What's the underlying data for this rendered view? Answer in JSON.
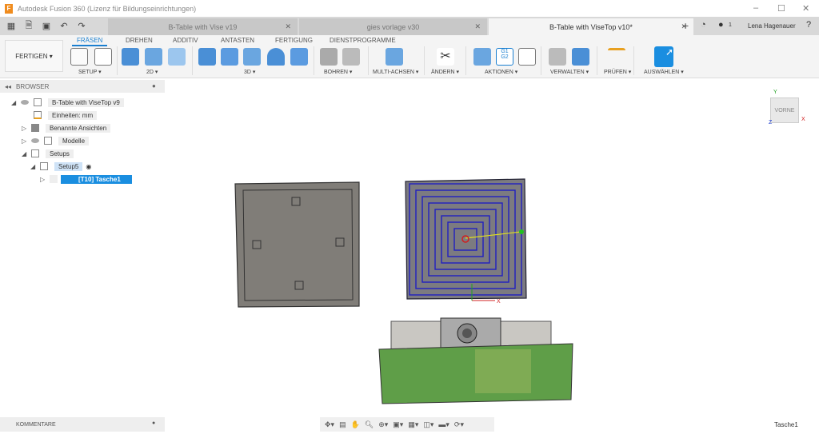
{
  "window": {
    "title": "Autodesk Fusion 360 (Lizenz für Bildungseinrichtungen)",
    "logo": "F"
  },
  "doc_tabs": [
    {
      "label": "B-Table with Vise v19"
    },
    {
      "label": "gies vorlage v30"
    },
    {
      "label": "B-Table with ViseTop v10*"
    }
  ],
  "user": {
    "name": "Lena Hagenauer",
    "jobs": "1"
  },
  "ribbon": {
    "workspace": "FERTIGEN ▾",
    "tabs": [
      "FRÄSEN",
      "DREHEN",
      "ADDITIV",
      "ANTASTEN",
      "FERTIGUNG",
      "DIENSTPROGRAMME"
    ],
    "groups": [
      "SETUP ▾",
      "2D ▾",
      "3D ▾",
      "BOHREN ▾",
      "MULTI-ACHSEN ▾",
      "ÄNDERN ▾",
      "AKTIONEN ▾",
      "VERWALTEN ▾",
      "PRÜFEN ▾",
      "AUSWÄHLEN ▾"
    ]
  },
  "browser": {
    "title": "BROWSER",
    "items": [
      {
        "label": "B-Table with ViseTop v9"
      },
      {
        "label": "Einheiten: mm"
      },
      {
        "label": "Benannte Ansichten"
      },
      {
        "label": "Modelle"
      },
      {
        "label": "Setups"
      },
      {
        "label": "Setup5"
      },
      {
        "label": "[T10] Tasche1"
      }
    ]
  },
  "comments": {
    "label": "KOMMENTARE"
  },
  "viewcube": {
    "label": "VORNE",
    "x": "X",
    "y": "Y",
    "z": "Z"
  },
  "status": {
    "selection": "Tasche1"
  },
  "colors": {
    "accent": "#1a7fd0",
    "part": "#807d78",
    "fixture": "#5f9e48",
    "toolpath": "#2020c0"
  }
}
